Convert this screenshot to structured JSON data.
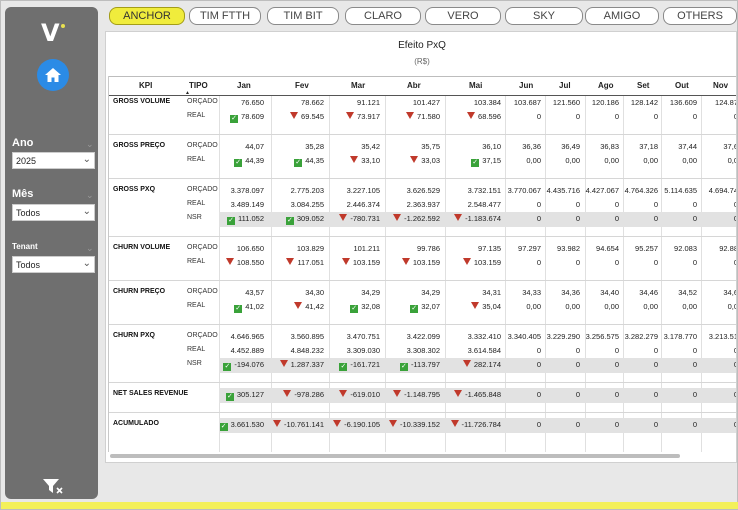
{
  "tabs": [
    {
      "label": "ANCHOR",
      "active": true
    },
    {
      "label": "TIM FTTH"
    },
    {
      "label": "TIM BIT"
    },
    {
      "label": "CLARO"
    },
    {
      "label": "VERO"
    },
    {
      "label": "SKY"
    },
    {
      "label": "AMIGO"
    },
    {
      "label": "OTHERS"
    }
  ],
  "sidebar": {
    "logo": "V",
    "ano_label": "Ano",
    "ano_value": "2025",
    "mes_label": "Mês",
    "mes_value": "Todos",
    "tenant_label": "Tenant",
    "tenant_value": "Todos"
  },
  "report": {
    "title": "Efeito PxQ",
    "subtitle": "(R$)"
  },
  "table": {
    "headers": [
      "KPI",
      "TIPO",
      "Jan",
      "Fev",
      "Mar",
      "Abr",
      "Mai",
      "Jun",
      "Jul",
      "Ago",
      "Set",
      "Out",
      "Nov"
    ],
    "rows": [
      {
        "kpi": "GROSS VOLUME",
        "tipo": "ORÇADO",
        "vals": [
          "76.650",
          "78.662",
          "91.121",
          "101.427",
          "103.384",
          "103.687",
          "121.560",
          "120.186",
          "128.142",
          "136.609",
          "124.87"
        ]
      },
      {
        "kpi": "",
        "tipo": "REAL",
        "ind": [
          "up",
          "down",
          "down",
          "down",
          "down"
        ],
        "vals": [
          "78.609",
          "69.545",
          "73.917",
          "71.580",
          "68.596",
          "0",
          "0",
          "0",
          "0",
          "0",
          "0"
        ]
      },
      {
        "kpi": "GROSS PREÇO",
        "tipo": "ORÇADO",
        "vals": [
          "44,07",
          "35,28",
          "35,42",
          "35,75",
          "36,10",
          "36,36",
          "36,49",
          "36,83",
          "37,18",
          "37,44",
          "37,6"
        ]
      },
      {
        "kpi": "",
        "tipo": "REAL",
        "ind": [
          "up",
          "up",
          "down",
          "down",
          "up"
        ],
        "vals": [
          "44,39",
          "44,35",
          "33,10",
          "33,03",
          "37,15",
          "0,00",
          "0,00",
          "0,00",
          "0,00",
          "0,00",
          "0,0"
        ]
      },
      {
        "kpi": "GROSS PXQ",
        "tipo": "ORÇADO",
        "vals": [
          "3.378.097",
          "2.775.203",
          "3.227.105",
          "3.626.529",
          "3.732.151",
          "3.770.067",
          "4.435.716",
          "4.427.067",
          "4.764.326",
          "5.114.635",
          "4.694.74"
        ]
      },
      {
        "kpi": "",
        "tipo": "REAL",
        "vals": [
          "3.489.149",
          "3.084.255",
          "2.446.374",
          "2.363.937",
          "2.548.477",
          "0",
          "0",
          "0",
          "0",
          "0",
          "0"
        ]
      },
      {
        "kpi": "",
        "tipo": "NSR",
        "ind": [
          "up",
          "up",
          "down",
          "down",
          "down"
        ],
        "shaded": true,
        "vals": [
          "111.052",
          "309.052",
          "-780.731",
          "-1.262.592",
          "-1.183.674",
          "0",
          "0",
          "0",
          "0",
          "0",
          "0"
        ]
      },
      {
        "kpi": "CHURN VOLUME",
        "tipo": "ORÇADO",
        "vals": [
          "106.650",
          "103.829",
          "101.211",
          "99.786",
          "97.135",
          "97.297",
          "93.982",
          "94.654",
          "95.257",
          "92.083",
          "92.88"
        ]
      },
      {
        "kpi": "",
        "tipo": "REAL",
        "ind": [
          "down",
          "down",
          "down",
          "down",
          "down"
        ],
        "vals": [
          "108.550",
          "117.051",
          "103.159",
          "103.159",
          "103.159",
          "0",
          "0",
          "0",
          "0",
          "0",
          "0"
        ]
      },
      {
        "kpi": "CHURN PREÇO",
        "tipo": "ORÇADO",
        "vals": [
          "43,57",
          "34,30",
          "34,29",
          "34,29",
          "34,31",
          "34,33",
          "34,36",
          "34,40",
          "34,46",
          "34,52",
          "34,6"
        ]
      },
      {
        "kpi": "",
        "tipo": "REAL",
        "ind": [
          "up",
          "down",
          "up",
          "up",
          "down"
        ],
        "vals": [
          "41,02",
          "41,42",
          "32,08",
          "32,07",
          "35,04",
          "0,00",
          "0,00",
          "0,00",
          "0,00",
          "0,00",
          "0,0"
        ]
      },
      {
        "kpi": "CHURN PXQ",
        "tipo": "ORÇADO",
        "vals": [
          "4.646.965",
          "3.560.895",
          "3.470.751",
          "3.422.099",
          "3.332.410",
          "3.340.405",
          "3.229.290",
          "3.256.575",
          "3.282.279",
          "3.178.770",
          "3.213.51"
        ]
      },
      {
        "kpi": "",
        "tipo": "REAL",
        "vals": [
          "4.452.889",
          "4.848.232",
          "3.309.030",
          "3.308.302",
          "3.614.584",
          "0",
          "0",
          "0",
          "0",
          "0",
          "0"
        ]
      },
      {
        "kpi": "",
        "tipo": "NSR",
        "ind": [
          "up",
          "down",
          "up",
          "up",
          "down"
        ],
        "shaded": true,
        "vals": [
          "-194.076",
          "1.287.337",
          "-161.721",
          "-113.797",
          "282.174",
          "0",
          "0",
          "0",
          "0",
          "0",
          "0"
        ]
      },
      {
        "kpi": "NET SALES REVENUE",
        "tipo": "",
        "ind": [
          "up",
          "down",
          "down",
          "down",
          "down"
        ],
        "shaded": true,
        "vals": [
          "305.127",
          "-978.286",
          "-619.010",
          "-1.148.795",
          "-1.465.848",
          "0",
          "0",
          "0",
          "0",
          "0",
          "0"
        ]
      },
      {
        "kpi": "ACUMULADO",
        "tipo": "",
        "ind": [
          "up",
          "down",
          "down",
          "down",
          "down"
        ],
        "shaded": true,
        "vals": [
          "3.661.530",
          "-10.761.141",
          "-6.190.105",
          "-10.339.152",
          "-11.726.784",
          "0",
          "0",
          "0",
          "0",
          "0",
          "0"
        ]
      }
    ]
  }
}
